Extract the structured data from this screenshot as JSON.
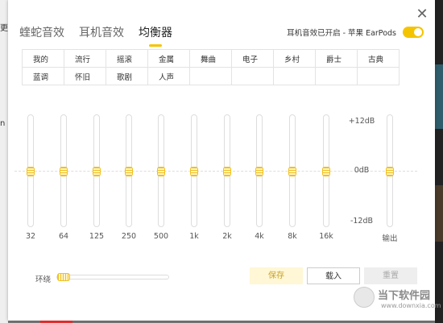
{
  "background": {
    "left_text_1": "更",
    "left_text_2": "n"
  },
  "tabs": [
    {
      "label": "蝰蛇音效",
      "active": false
    },
    {
      "label": "耳机音效",
      "active": false
    },
    {
      "label": "均衡器",
      "active": true
    }
  ],
  "earphone": {
    "label": "耳机音效已开启 - 苹果 EarPods",
    "enabled": true
  },
  "presets": [
    [
      "我的",
      "流行",
      "摇滚",
      "金属",
      "舞曲",
      "电子",
      "乡村",
      "爵士",
      "古典"
    ],
    [
      "蓝调",
      "怀旧",
      "歌剧",
      "人声",
      "",
      "",
      "",
      "",
      ""
    ]
  ],
  "eq": {
    "db_labels": {
      "top": "+12dB",
      "mid": "0dB",
      "bottom": "-12dB"
    },
    "bands": [
      {
        "freq": "32",
        "gain_db": 0
      },
      {
        "freq": "64",
        "gain_db": 0
      },
      {
        "freq": "125",
        "gain_db": 0
      },
      {
        "freq": "250",
        "gain_db": 0
      },
      {
        "freq": "500",
        "gain_db": 0
      },
      {
        "freq": "1k",
        "gain_db": 0
      },
      {
        "freq": "2k",
        "gain_db": 0
      },
      {
        "freq": "4k",
        "gain_db": 0
      },
      {
        "freq": "8k",
        "gain_db": 0
      },
      {
        "freq": "16k",
        "gain_db": 0
      }
    ],
    "output": {
      "label": "输出",
      "gain_db": 0
    }
  },
  "surround": {
    "label": "环绕",
    "value": 0
  },
  "buttons": {
    "save": "保存",
    "load": "载入",
    "reset": "重置"
  },
  "watermark": {
    "text": "当下软件园",
    "url": "www.downxia.com"
  },
  "colors": {
    "accent": "#f5c400"
  }
}
